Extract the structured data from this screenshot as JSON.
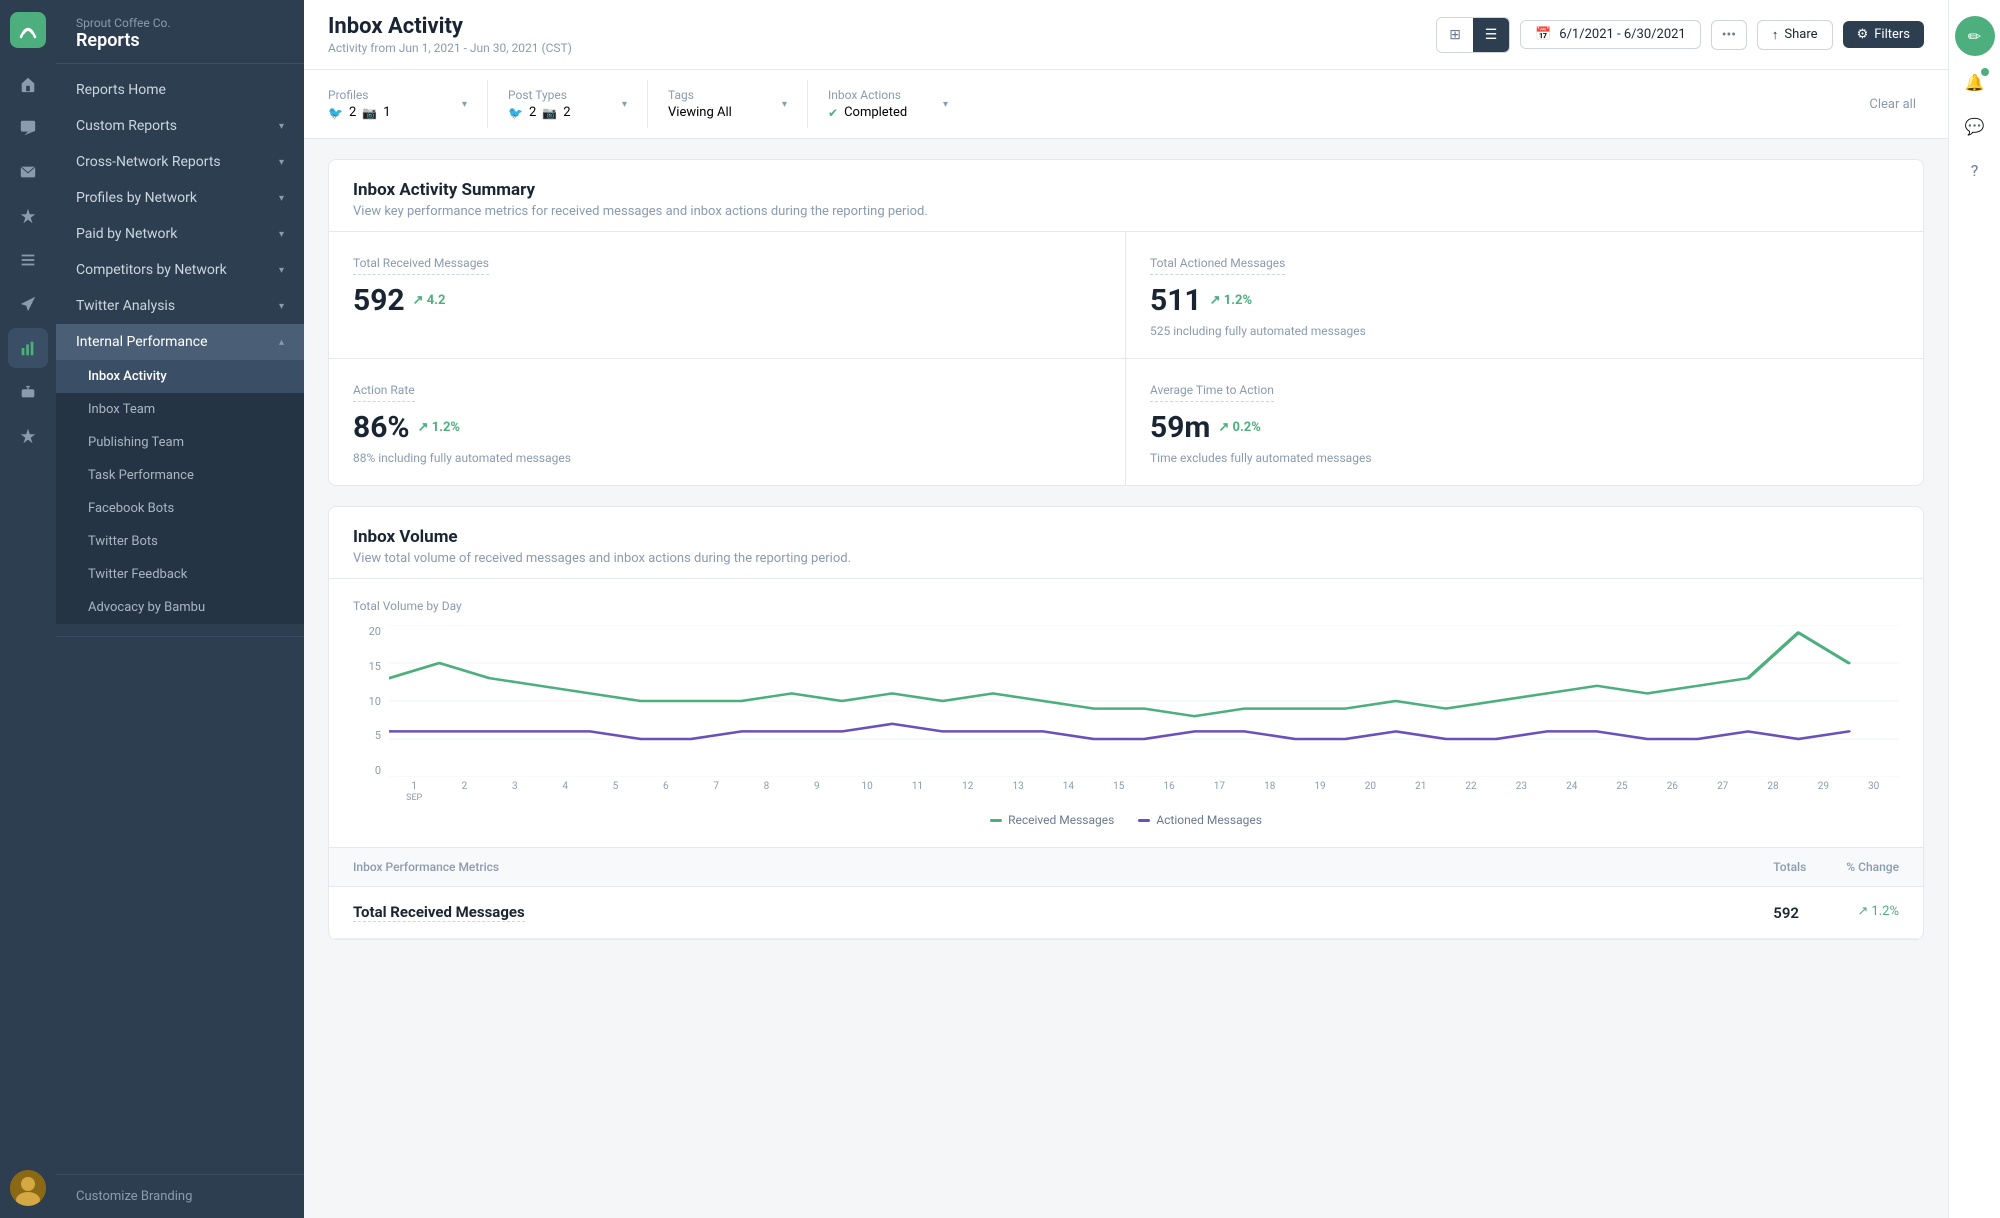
{
  "company": "Sprout Coffee Co.",
  "sidebar_title": "Reports",
  "nav_items": [
    {
      "label": "Reports Home",
      "has_sub": false,
      "active": false
    },
    {
      "label": "Custom Reports",
      "has_sub": true,
      "active": false
    },
    {
      "label": "Cross-Network Reports",
      "has_sub": true,
      "active": false
    },
    {
      "label": "Profiles by Network",
      "has_sub": true,
      "active": false
    },
    {
      "label": "Paid by Network",
      "has_sub": true,
      "active": false
    },
    {
      "label": "Competitors by Network",
      "has_sub": true,
      "active": false
    },
    {
      "label": "Twitter Analysis",
      "has_sub": true,
      "active": false
    },
    {
      "label": "Internal Performance",
      "has_sub": true,
      "active": true,
      "expanded": true
    }
  ],
  "sub_items": [
    {
      "label": "Inbox Activity",
      "active": true
    },
    {
      "label": "Inbox Team",
      "active": false
    },
    {
      "label": "Publishing Team",
      "active": false
    },
    {
      "label": "Task Performance",
      "active": false
    },
    {
      "label": "Facebook Bots",
      "active": false
    },
    {
      "label": "Twitter Bots",
      "active": false
    },
    {
      "label": "Twitter Feedback",
      "active": false
    },
    {
      "label": "Advocacy by Bambu",
      "active": false
    }
  ],
  "customize_branding": "Customize Branding",
  "page_title": "Inbox Activity",
  "page_subtitle": "Activity from Jun 1, 2021 - Jun 30, 2021 (CST)",
  "date_range": "6/1/2021 - 6/30/2021",
  "share_label": "Share",
  "filters_label": "Filters",
  "filters": {
    "profiles": {
      "label": "Profiles",
      "twitter_count": "2",
      "instagram_count": "1"
    },
    "post_types": {
      "label": "Post Types",
      "twitter_count": "2",
      "instagram_count": "2"
    },
    "tags": {
      "label": "Tags",
      "value": "Viewing All"
    },
    "inbox_actions": {
      "label": "Inbox Actions",
      "value": "Completed"
    }
  },
  "clear_all": "Clear all",
  "summary_title": "Inbox Activity Summary",
  "summary_desc": "View key performance metrics for received messages and inbox actions during the reporting period.",
  "metrics": {
    "total_received": {
      "label": "Total Received Messages",
      "value": "592",
      "trend": "↗ 4.2"
    },
    "total_actioned": {
      "label": "Total Actioned Messages",
      "value": "511",
      "trend": "↗ 1.2%",
      "sub": "525 including fully automated messages"
    },
    "action_rate": {
      "label": "Action Rate",
      "value": "86%",
      "trend": "↗ 1.2%",
      "sub": "88% including fully automated messages"
    },
    "avg_time": {
      "label": "Average Time to Action",
      "value": "59m",
      "trend": "↗ 0.2%",
      "sub": "Time excludes fully automated messages"
    }
  },
  "volume_title": "Inbox Volume",
  "volume_desc": "View total volume of received messages and inbox actions during the reporting period.",
  "chart": {
    "title": "Total Volume by Day",
    "y_labels": [
      "20",
      "15",
      "10",
      "5",
      "0"
    ],
    "x_labels": [
      "1",
      "2",
      "3",
      "4",
      "5",
      "6",
      "7",
      "8",
      "9",
      "10",
      "11",
      "12",
      "13",
      "14",
      "15",
      "16",
      "17",
      "18",
      "19",
      "20",
      "21",
      "22",
      "23",
      "24",
      "25",
      "26",
      "27",
      "28",
      "29",
      "30"
    ],
    "x_sub": "SEP",
    "legend": [
      {
        "label": "Received Messages",
        "color": "#4caf7d"
      },
      {
        "label": "Actioned Messages",
        "color": "#6b4fbb"
      }
    ],
    "received_values": [
      13,
      15,
      13,
      12,
      11,
      10,
      10,
      10,
      11,
      10,
      11,
      10,
      11,
      10,
      9,
      9,
      8,
      9,
      9,
      9,
      10,
      9,
      10,
      11,
      12,
      11,
      12,
      13,
      19,
      15
    ],
    "actioned_values": [
      6,
      6,
      6,
      6,
      6,
      5,
      5,
      6,
      6,
      6,
      7,
      6,
      6,
      6,
      5,
      5,
      6,
      6,
      5,
      5,
      6,
      5,
      5,
      6,
      6,
      5,
      5,
      6,
      5,
      6
    ]
  },
  "table": {
    "header_label": "Inbox Performance Metrics",
    "totals_col": "Totals",
    "change_col": "% Change",
    "row_label": "Total Received Messages",
    "row_value": "592",
    "row_change": "↗ 1.2%"
  }
}
